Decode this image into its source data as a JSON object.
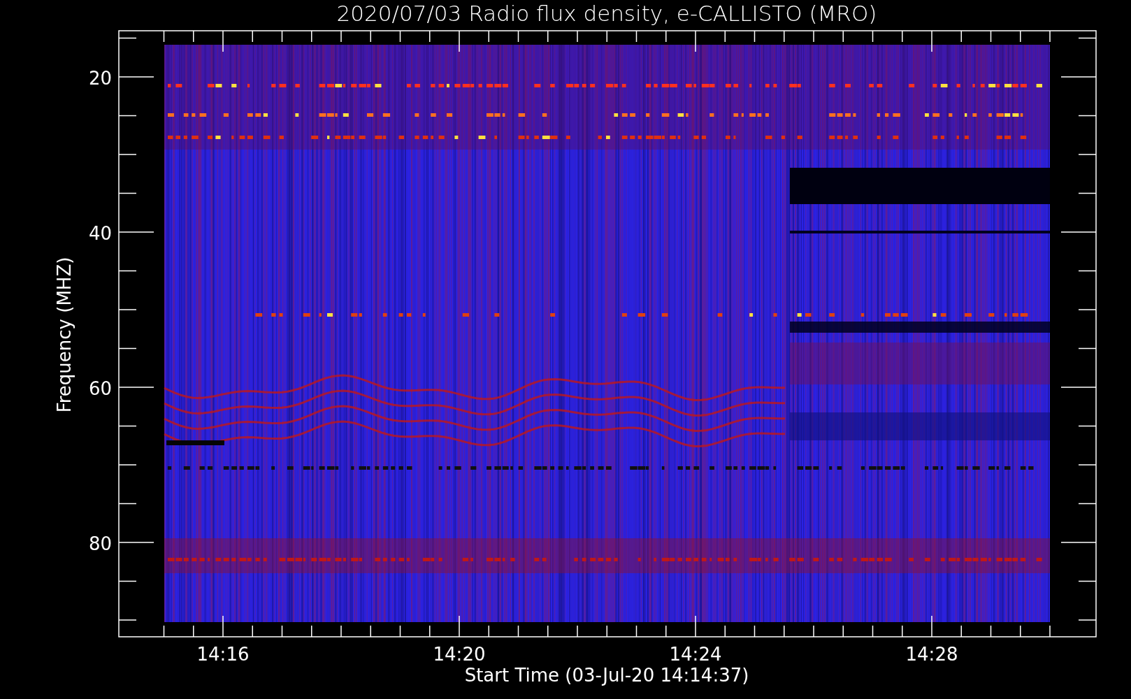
{
  "title": "2020/07/03  Radio flux density, e-CALLISTO (MRO)",
  "y_axis": {
    "label": "Frequency (MHZ)",
    "tick_labels": [
      "20",
      "40",
      "60",
      "80"
    ]
  },
  "x_axis": {
    "label": "Start Time (03-Jul-20 14:14:37)",
    "tick_labels": [
      "14:16",
      "14:20",
      "14:24",
      "14:28"
    ]
  }
}
